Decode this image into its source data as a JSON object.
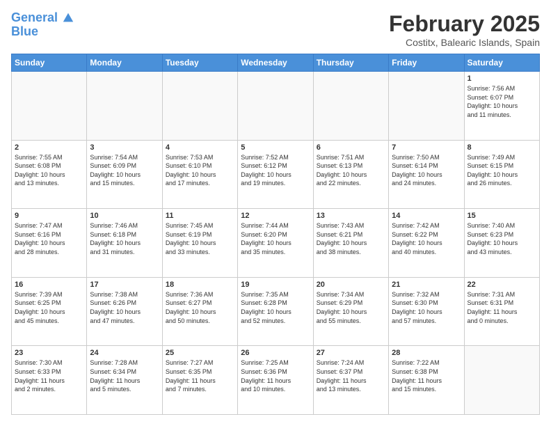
{
  "header": {
    "logo_line1": "General",
    "logo_line2": "Blue",
    "month_title": "February 2025",
    "location": "Costitx, Balearic Islands, Spain"
  },
  "days_of_week": [
    "Sunday",
    "Monday",
    "Tuesday",
    "Wednesday",
    "Thursday",
    "Friday",
    "Saturday"
  ],
  "weeks": [
    [
      {
        "day": "",
        "info": ""
      },
      {
        "day": "",
        "info": ""
      },
      {
        "day": "",
        "info": ""
      },
      {
        "day": "",
        "info": ""
      },
      {
        "day": "",
        "info": ""
      },
      {
        "day": "",
        "info": ""
      },
      {
        "day": "1",
        "info": "Sunrise: 7:56 AM\nSunset: 6:07 PM\nDaylight: 10 hours\nand 11 minutes."
      }
    ],
    [
      {
        "day": "2",
        "info": "Sunrise: 7:55 AM\nSunset: 6:08 PM\nDaylight: 10 hours\nand 13 minutes."
      },
      {
        "day": "3",
        "info": "Sunrise: 7:54 AM\nSunset: 6:09 PM\nDaylight: 10 hours\nand 15 minutes."
      },
      {
        "day": "4",
        "info": "Sunrise: 7:53 AM\nSunset: 6:10 PM\nDaylight: 10 hours\nand 17 minutes."
      },
      {
        "day": "5",
        "info": "Sunrise: 7:52 AM\nSunset: 6:12 PM\nDaylight: 10 hours\nand 19 minutes."
      },
      {
        "day": "6",
        "info": "Sunrise: 7:51 AM\nSunset: 6:13 PM\nDaylight: 10 hours\nand 22 minutes."
      },
      {
        "day": "7",
        "info": "Sunrise: 7:50 AM\nSunset: 6:14 PM\nDaylight: 10 hours\nand 24 minutes."
      },
      {
        "day": "8",
        "info": "Sunrise: 7:49 AM\nSunset: 6:15 PM\nDaylight: 10 hours\nand 26 minutes."
      }
    ],
    [
      {
        "day": "9",
        "info": "Sunrise: 7:47 AM\nSunset: 6:16 PM\nDaylight: 10 hours\nand 28 minutes."
      },
      {
        "day": "10",
        "info": "Sunrise: 7:46 AM\nSunset: 6:18 PM\nDaylight: 10 hours\nand 31 minutes."
      },
      {
        "day": "11",
        "info": "Sunrise: 7:45 AM\nSunset: 6:19 PM\nDaylight: 10 hours\nand 33 minutes."
      },
      {
        "day": "12",
        "info": "Sunrise: 7:44 AM\nSunset: 6:20 PM\nDaylight: 10 hours\nand 35 minutes."
      },
      {
        "day": "13",
        "info": "Sunrise: 7:43 AM\nSunset: 6:21 PM\nDaylight: 10 hours\nand 38 minutes."
      },
      {
        "day": "14",
        "info": "Sunrise: 7:42 AM\nSunset: 6:22 PM\nDaylight: 10 hours\nand 40 minutes."
      },
      {
        "day": "15",
        "info": "Sunrise: 7:40 AM\nSunset: 6:23 PM\nDaylight: 10 hours\nand 43 minutes."
      }
    ],
    [
      {
        "day": "16",
        "info": "Sunrise: 7:39 AM\nSunset: 6:25 PM\nDaylight: 10 hours\nand 45 minutes."
      },
      {
        "day": "17",
        "info": "Sunrise: 7:38 AM\nSunset: 6:26 PM\nDaylight: 10 hours\nand 47 minutes."
      },
      {
        "day": "18",
        "info": "Sunrise: 7:36 AM\nSunset: 6:27 PM\nDaylight: 10 hours\nand 50 minutes."
      },
      {
        "day": "19",
        "info": "Sunrise: 7:35 AM\nSunset: 6:28 PM\nDaylight: 10 hours\nand 52 minutes."
      },
      {
        "day": "20",
        "info": "Sunrise: 7:34 AM\nSunset: 6:29 PM\nDaylight: 10 hours\nand 55 minutes."
      },
      {
        "day": "21",
        "info": "Sunrise: 7:32 AM\nSunset: 6:30 PM\nDaylight: 10 hours\nand 57 minutes."
      },
      {
        "day": "22",
        "info": "Sunrise: 7:31 AM\nSunset: 6:31 PM\nDaylight: 11 hours\nand 0 minutes."
      }
    ],
    [
      {
        "day": "23",
        "info": "Sunrise: 7:30 AM\nSunset: 6:33 PM\nDaylight: 11 hours\nand 2 minutes."
      },
      {
        "day": "24",
        "info": "Sunrise: 7:28 AM\nSunset: 6:34 PM\nDaylight: 11 hours\nand 5 minutes."
      },
      {
        "day": "25",
        "info": "Sunrise: 7:27 AM\nSunset: 6:35 PM\nDaylight: 11 hours\nand 7 minutes."
      },
      {
        "day": "26",
        "info": "Sunrise: 7:25 AM\nSunset: 6:36 PM\nDaylight: 11 hours\nand 10 minutes."
      },
      {
        "day": "27",
        "info": "Sunrise: 7:24 AM\nSunset: 6:37 PM\nDaylight: 11 hours\nand 13 minutes."
      },
      {
        "day": "28",
        "info": "Sunrise: 7:22 AM\nSunset: 6:38 PM\nDaylight: 11 hours\nand 15 minutes."
      },
      {
        "day": "",
        "info": ""
      }
    ]
  ]
}
